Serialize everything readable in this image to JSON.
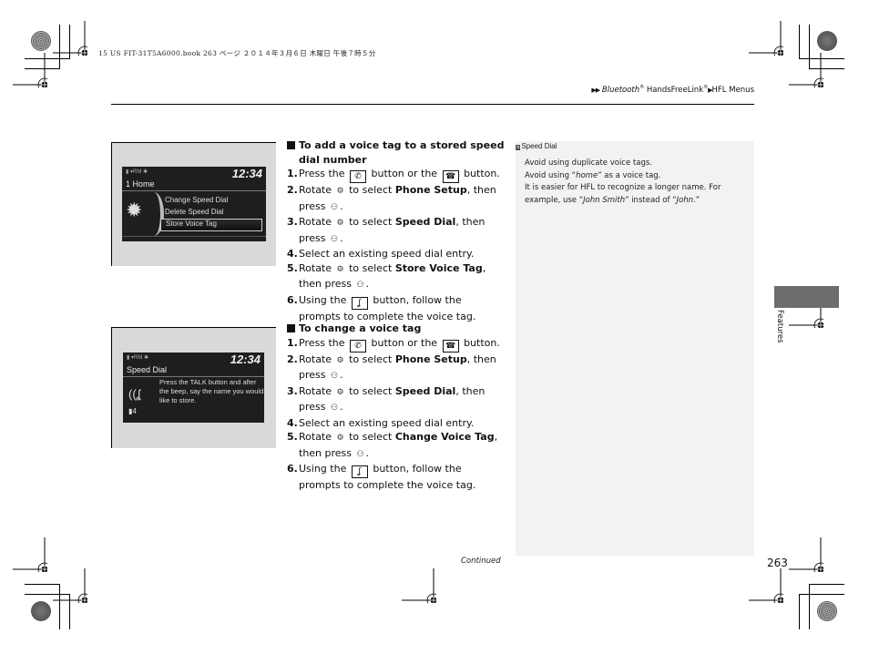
{
  "print_info": "15 US FIT-31T5A6000.book  263 ページ  ２０１４年３月６日  木曜日  午後７時５分",
  "breadcrumb": {
    "items": [
      "Bluetooth",
      "HandsFreeLink",
      "HFL Menus"
    ],
    "registered_mark": "®"
  },
  "screens": [
    {
      "status": "▮ ▾RM ✱",
      "clock": "12:34",
      "title": "1 Home",
      "icon": "gear-icon",
      "menu": [
        {
          "label": "Change Speed Dial",
          "selected": false
        },
        {
          "label": "Delete Speed Dial",
          "selected": false
        },
        {
          "label": "Store Voice Tag",
          "selected": true
        }
      ]
    },
    {
      "status": "▮ ▾RM ✱",
      "clock": "12:34",
      "title": "Speed Dial",
      "icon": "voice-tag-icon",
      "entry_number": "4",
      "prompt": "Press the TALK button and after the beep, say the name you would like to store."
    }
  ],
  "sections": [
    {
      "heading": "To add a voice tag to a stored speed dial number",
      "steps": [
        {
          "num": "1.",
          "pre": "Press the",
          "icon1": "phone-icon",
          "mid": "button or the",
          "icon2": "pick-up-icon",
          "post": "button."
        },
        {
          "num": "2.",
          "pre": "Rotate",
          "knob": "interface-dial-icon",
          "mid": "to select",
          "bold": "Phone Setup",
          "post": ", then press",
          "press": "interface-dial-press-icon",
          "end": "."
        },
        {
          "num": "3.",
          "pre": "Rotate",
          "knob": "interface-dial-icon",
          "mid": "to select",
          "bold": "Speed Dial",
          "post": ", then press",
          "press": "interface-dial-press-icon",
          "end": "."
        },
        {
          "num": "4.",
          "text": "Select an existing speed dial entry."
        },
        {
          "num": "5.",
          "pre": "Rotate",
          "knob": "interface-dial-icon",
          "mid": "to select",
          "bold": "Store Voice Tag",
          "post": ", then press",
          "press": "interface-dial-press-icon",
          "end": "."
        },
        {
          "num": "6.",
          "pre": "Using the",
          "icon1": "talk-button-icon",
          "post": "button, follow the prompts to complete the voice tag."
        }
      ]
    },
    {
      "heading": "To change a voice tag",
      "steps": [
        {
          "num": "1.",
          "pre": "Press the",
          "icon1": "phone-icon",
          "mid": "button or the",
          "icon2": "pick-up-icon",
          "post": "button."
        },
        {
          "num": "2.",
          "pre": "Rotate",
          "knob": "interface-dial-icon",
          "mid": "to select",
          "bold": "Phone Setup",
          "post": ", then press",
          "press": "interface-dial-press-icon",
          "end": "."
        },
        {
          "num": "3.",
          "pre": "Rotate",
          "knob": "interface-dial-icon",
          "mid": "to select",
          "bold": "Speed Dial",
          "post": ", then press",
          "press": "interface-dial-press-icon",
          "end": "."
        },
        {
          "num": "4.",
          "text": "Select an existing speed dial entry."
        },
        {
          "num": "5.",
          "pre": "Rotate",
          "knob": "interface-dial-icon",
          "mid": "to select",
          "bold": "Change Voice Tag",
          "post": ", then press",
          "press": "interface-dial-press-icon",
          "end": "."
        },
        {
          "num": "6.",
          "pre": "Using the",
          "icon1": "talk-button-icon",
          "post": "button, follow the prompts to complete the voice tag."
        }
      ]
    }
  ],
  "note": {
    "marker": "»",
    "title": "Speed Dial",
    "lines": [
      "Avoid using duplicate voice tags.",
      "Avoid using “home” as a voice tag.",
      "It is easier for HFL to recognize a longer name. For example, use “John Smith” instead of “John.”"
    ]
  },
  "footer": {
    "continued": "Continued",
    "page_number": "263"
  },
  "side_tab": {
    "label": "Features",
    "color": "#6d6d6d"
  }
}
